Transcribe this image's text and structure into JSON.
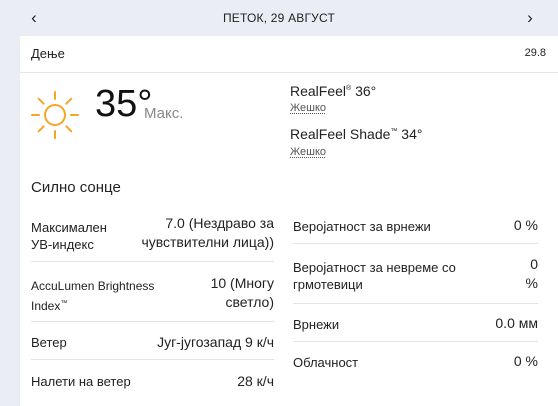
{
  "nav": {
    "date_title": "ПЕТОК, 29 АВГУСТ",
    "prev_glyph": "‹",
    "next_glyph": "›"
  },
  "card": {
    "period_label": "Дење",
    "header_value": "29.8",
    "icon": "sun-icon",
    "icon_color": "#f5a623",
    "temperature": "35°",
    "temperature_label": "Макс.",
    "realfeel_label": "RealFeel",
    "realfeel_mark": "®",
    "realfeel_value": "36°",
    "realfeel_desc": "Жешко",
    "realfeel_shade_label": "RealFeel Shade",
    "realfeel_shade_mark": "™",
    "realfeel_shade_value": "34°",
    "realfeel_shade_desc": "Жешко",
    "condition": "Силно сонце"
  },
  "details_left": [
    {
      "label": "Максимален УВ-индекс",
      "value": "7.0 (Нездраво за чувствителни лица))"
    },
    {
      "label": "AccuLumen Brightness Index",
      "label_mark": "™",
      "value": "10 (Многу светло)"
    },
    {
      "label": "Ветер",
      "value": "Југ-југозапад 9 к/ч"
    },
    {
      "label": "Налети на ветер",
      "value": "28 к/ч"
    }
  ],
  "details_right": [
    {
      "label": "Веројатност за врнежи",
      "value": "0 %"
    },
    {
      "label": "Веројатност за невреме со грмотевици",
      "value": "0 %"
    },
    {
      "label": "Врнежи",
      "value": "0.0 мм"
    },
    {
      "label": "Облачност",
      "value": "0 %"
    }
  ]
}
